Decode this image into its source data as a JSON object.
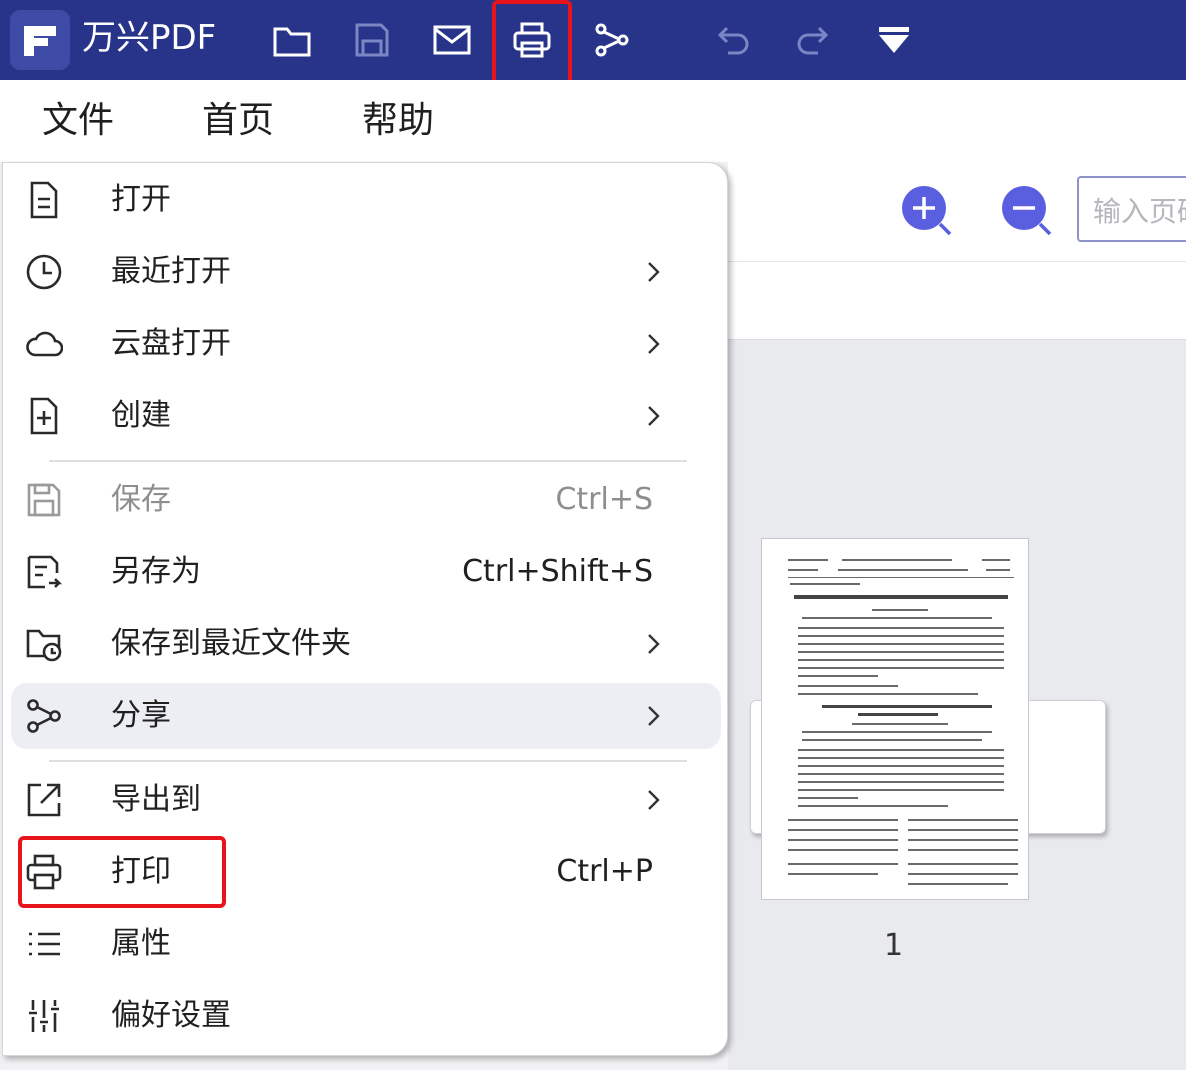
{
  "app": {
    "title": "万兴PDF",
    "logo_icon": "wondershare-pdf-logo-icon",
    "brand_color": "#27348a",
    "highlight_color": "#e8141c"
  },
  "toolbar": {
    "icons": [
      "folder-open-icon",
      "save-icon",
      "mail-icon",
      "printer-icon",
      "share-icon",
      "undo-icon",
      "redo-icon",
      "quick-access-dropdown-icon"
    ]
  },
  "menubar": {
    "items": [
      "文件",
      "首页",
      "帮助"
    ]
  },
  "view": {
    "zoom_in_icon": "zoom-in-icon",
    "zoom_out_icon": "zoom-out-icon",
    "page_input_placeholder": "输入页码",
    "thumbnail_page_number": "1"
  },
  "file_menu": {
    "items": [
      {
        "icon": "document-icon",
        "label": "打开",
        "shortcut": "",
        "submenu": false,
        "disabled": false
      },
      {
        "icon": "clock-icon",
        "label": "最近打开",
        "shortcut": "",
        "submenu": true,
        "disabled": false
      },
      {
        "icon": "cloud-icon",
        "label": "云盘打开",
        "shortcut": "",
        "submenu": true,
        "disabled": false
      },
      {
        "icon": "add-document-icon",
        "label": "创建",
        "shortcut": "",
        "submenu": true,
        "disabled": false
      },
      {
        "icon": "save-icon",
        "label": "保存",
        "shortcut": "Ctrl+S",
        "submenu": false,
        "disabled": true
      },
      {
        "icon": "save-as-icon",
        "label": "另存为",
        "shortcut": "Ctrl+Shift+S",
        "submenu": false,
        "disabled": false
      },
      {
        "icon": "folder-clock-icon",
        "label": "保存到最近文件夹",
        "shortcut": "",
        "submenu": true,
        "disabled": false
      },
      {
        "icon": "share-icon",
        "label": "分享",
        "shortcut": "",
        "submenu": true,
        "disabled": false
      },
      {
        "icon": "export-icon",
        "label": "导出到",
        "shortcut": "",
        "submenu": true,
        "disabled": false
      },
      {
        "icon": "printer-icon",
        "label": "打印",
        "shortcut": "Ctrl+P",
        "submenu": false,
        "disabled": false
      },
      {
        "icon": "list-icon",
        "label": "属性",
        "shortcut": "",
        "submenu": false,
        "disabled": false
      },
      {
        "icon": "sliders-icon",
        "label": "偏好设置",
        "shortcut": "",
        "submenu": false,
        "disabled": false
      }
    ]
  }
}
